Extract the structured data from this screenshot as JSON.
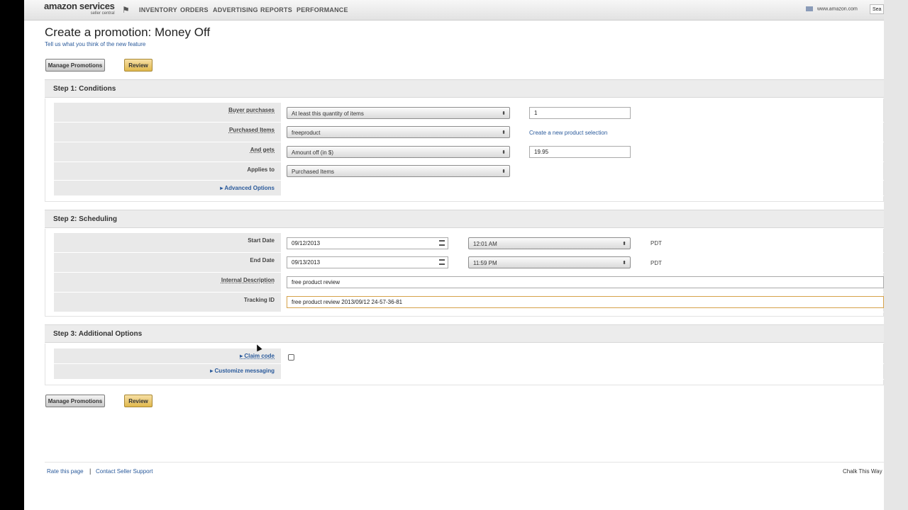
{
  "topbar": {
    "logo_main": "amazon services",
    "logo_sub": "seller central",
    "nav": [
      "INVENTORY",
      "ORDERS",
      "ADVERTISING",
      "REPORTS",
      "PERFORMANCE"
    ],
    "site": "www.amazon.com",
    "search_label": "Sea"
  },
  "page": {
    "title": "Create a promotion: Money Off",
    "subtitle": "Tell us what you think of the new feature",
    "manage_button": "Manage Promotions",
    "review_button": "Review"
  },
  "step1": {
    "title": "Step 1: Conditions",
    "buyer_purchases_label": "Buyer purchases",
    "buyer_purchases_value": "At least this quantity of items",
    "buyer_purchases_qty": "1",
    "purchased_items_label": "Purchased Items",
    "purchased_items_value": "freeproduct",
    "create_selection_link": "Create a new product selection",
    "and_gets_label": "And gets",
    "and_gets_value": "Amount off (in $)",
    "and_gets_amount": "19.95",
    "applies_to_label": "Applies to",
    "applies_to_value": "Purchased Items",
    "advanced_options": "Advanced Options"
  },
  "step2": {
    "title": "Step 2: Scheduling",
    "start_date_label": "Start Date",
    "start_date": "09/12/2013",
    "start_time": "12:01 AM",
    "end_date_label": "End Date",
    "end_date": "09/13/2013",
    "end_time": "11:59 PM",
    "timezone": "PDT",
    "internal_desc_label": "Internal Description",
    "internal_desc": "free product review",
    "tracking_label": "Tracking ID",
    "tracking_id": "free product review 2013/09/12 24-57-36-81"
  },
  "step3": {
    "title": "Step 3: Additional Options",
    "claim_code": "Claim code",
    "customize_messaging": "Customize messaging"
  },
  "footer": {
    "rate": "Rate this page",
    "separator": "|",
    "contact": "Contact Seller Support",
    "right": "Chalk This Way"
  }
}
